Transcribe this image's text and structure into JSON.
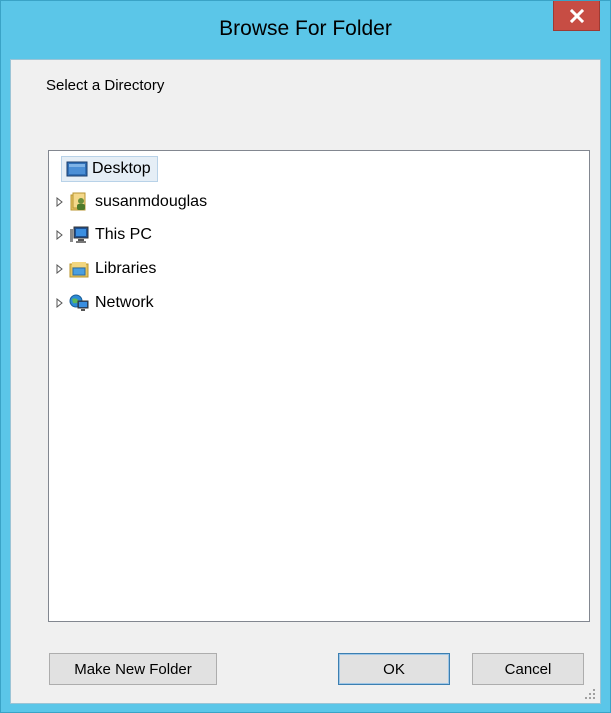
{
  "window": {
    "title": "Browse For Folder",
    "close_label": "x"
  },
  "dialog": {
    "prompt": "Select a Directory"
  },
  "tree": {
    "items": [
      {
        "label": "Desktop",
        "icon": "desktop-icon",
        "selected": true,
        "expandable": false
      },
      {
        "label": "susanmdouglas",
        "icon": "user-folder-icon",
        "selected": false,
        "expandable": true
      },
      {
        "label": "This PC",
        "icon": "computer-icon",
        "selected": false,
        "expandable": true
      },
      {
        "label": "Libraries",
        "icon": "libraries-icon",
        "selected": false,
        "expandable": true
      },
      {
        "label": "Network",
        "icon": "network-icon",
        "selected": false,
        "expandable": true
      }
    ]
  },
  "buttons": {
    "make_new_folder": "Make New Folder",
    "ok": "OK",
    "cancel": "Cancel"
  },
  "colors": {
    "title_bar": "#5bc6e8",
    "close_button": "#c74d44",
    "selection": "#e5eef6"
  }
}
